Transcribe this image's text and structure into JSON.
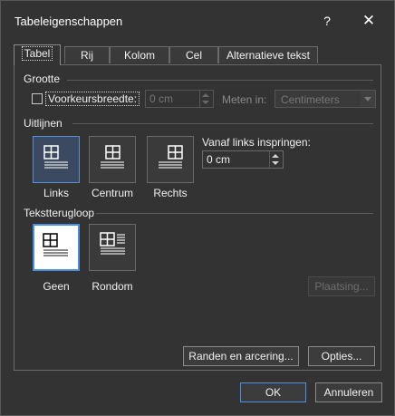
{
  "window": {
    "title": "Tabeleigenschappen",
    "help": "?",
    "close": "✕"
  },
  "tabs": [
    {
      "label": "Tabel",
      "active": true
    },
    {
      "label": "Rij"
    },
    {
      "label": "Kolom"
    },
    {
      "label": "Cel"
    },
    {
      "label": "Alternatieve tekst"
    }
  ],
  "grootte": {
    "heading": "Grootte",
    "pref_width_label": "Voorkeursbreedte:",
    "pref_width_value": "0 cm",
    "meten_in_label": "Meten in:",
    "meten_in_value": "Centimeters"
  },
  "uitlijnen": {
    "heading": "Uitlijnen",
    "options": [
      "Links",
      "Centrum",
      "Rechts"
    ],
    "indent_label": "Vanaf links inspringen:",
    "indent_value": "0 cm"
  },
  "tekstterugloop": {
    "heading": "Tekstterugloop",
    "options": [
      "Geen",
      "Rondom"
    ],
    "placement_button": "Plaatsing..."
  },
  "buttons": {
    "borders": "Randen en arcering...",
    "options": "Opties...",
    "ok": "OK",
    "cancel": "Annuleren"
  },
  "colors": {
    "accent": "#4a90e2",
    "background": "#333333"
  }
}
